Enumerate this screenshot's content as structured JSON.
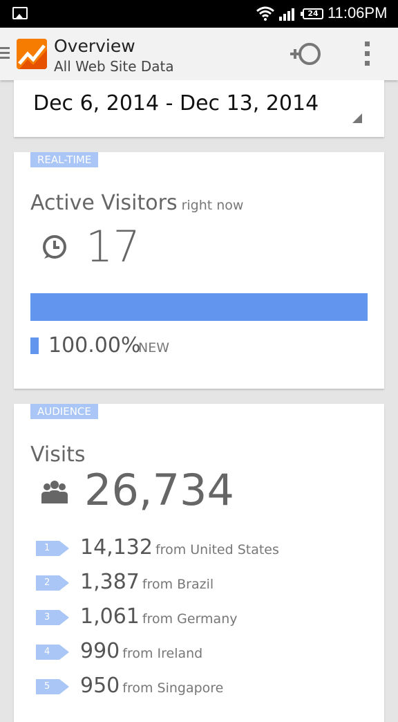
{
  "status_bar": {
    "battery": "24",
    "time": "11:06PM"
  },
  "action_bar": {
    "title": "Overview",
    "subtitle": "All Web Site Data"
  },
  "date_range": {
    "label": "Dec 6, 2014 - Dec 13, 2014"
  },
  "realtime": {
    "tag": "REAL-TIME",
    "heading": "Active Visitors",
    "heading_suffix": "right now",
    "value": "17",
    "new_share": 1.0,
    "legend_percent": "100.00%",
    "legend_label": "NEW",
    "bar_color": "#6295ed"
  },
  "audience": {
    "tag": "AUDIENCE",
    "heading": "Visits",
    "value": "26,734",
    "countries": [
      {
        "rank": "1",
        "value": "14,132",
        "label": "from United States"
      },
      {
        "rank": "2",
        "value": "1,387",
        "label": "from Brazil"
      },
      {
        "rank": "3",
        "value": "1,061",
        "label": "from Germany"
      },
      {
        "rank": "4",
        "value": "990",
        "label": "from Ireland"
      },
      {
        "rank": "5",
        "value": "950",
        "label": "from Singapore"
      }
    ]
  },
  "colors": {
    "accent": "#a9c6f6",
    "bar": "#6295ed",
    "logo": "#f57c00"
  }
}
